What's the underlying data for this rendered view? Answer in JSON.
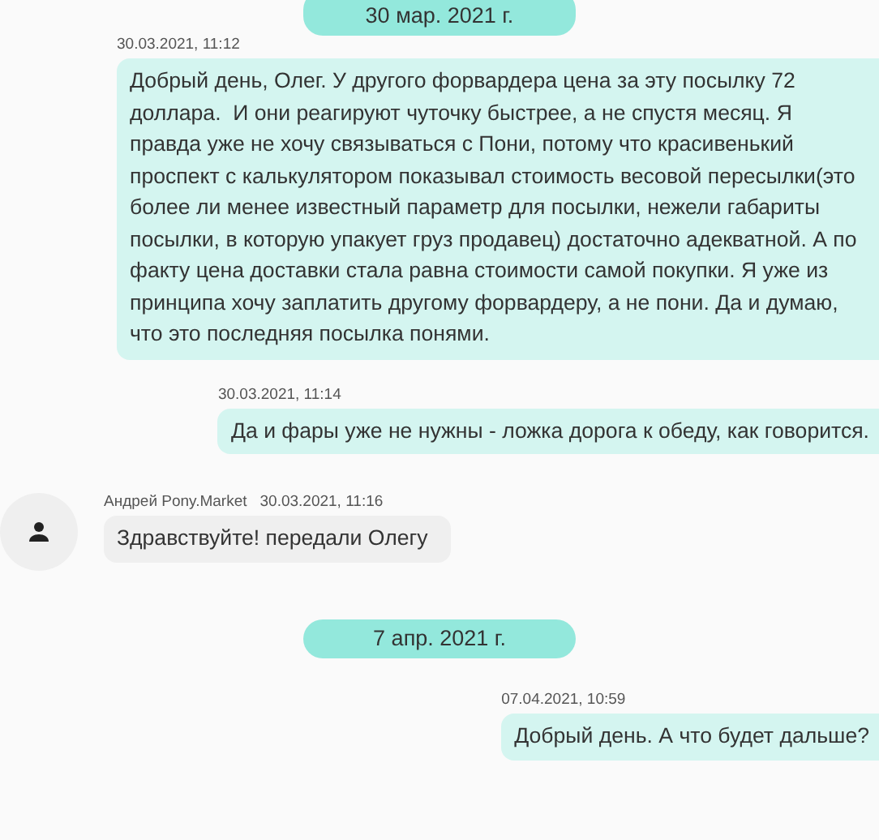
{
  "messages": [
    {
      "kind": "date",
      "text": "30 мар. 2021 г."
    },
    {
      "kind": "outgoing",
      "time": "30.03.2021, 11:12",
      "text": "Добрый день, Олег. У другого форвардера цена за эту посылку 72 доллара.  И они реагируют чуточку быстрее, а не спустя месяц. Я правда уже не хочу связываться с Пони, потому что красивенький проспект с калькулятором показывал стоимость весовой пересылки(это более ли менее известный параметр для посылки, нежели габариты посылки, в которую упакует груз продавец) достаточно адекватной. А по факту цена доставки стала равна стоимости самой покупки. Я уже из принципа хочу заплатить другому форвардеру, а не пони. Да и думаю, что это последняя посылка понями."
    },
    {
      "kind": "outgoing",
      "time": "30.03.2021, 11:14",
      "text": "Да и фары уже не нужны - ложка дорога к обеду, как говорится."
    },
    {
      "kind": "incoming",
      "author": "Андрей Pony.Market",
      "time": "30.03.2021, 11:16",
      "text": "Здравствуйте! передали Олегу"
    },
    {
      "kind": "date",
      "text": "7 апр. 2021 г."
    },
    {
      "kind": "outgoing",
      "time": "07.04.2021, 10:59",
      "text": "Добрый день. А что будет дальше?"
    }
  ]
}
